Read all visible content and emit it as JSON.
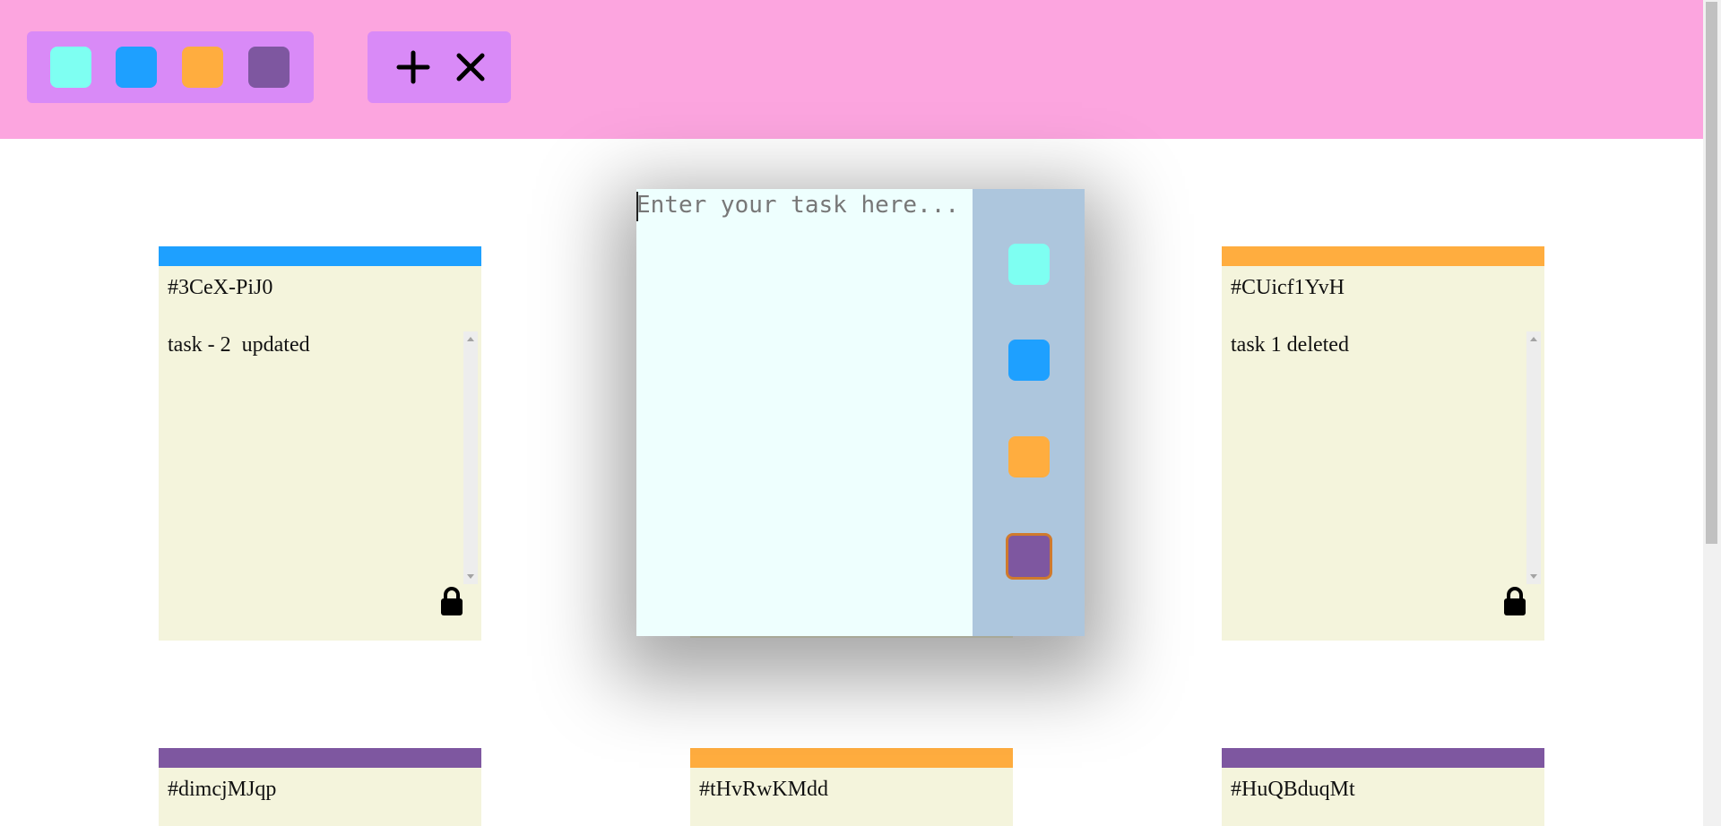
{
  "filter_colors": [
    {
      "name": "lightcyan-filter",
      "color": "#7efff2"
    },
    {
      "name": "blue-filter",
      "color": "#1ea0ff"
    },
    {
      "name": "orange-filter",
      "color": "#ffad3f"
    },
    {
      "name": "purple-filter",
      "color": "#7e57a0"
    }
  ],
  "actions": {
    "add_icon": "plus-icon",
    "remove_icon": "close-icon"
  },
  "tickets": [
    {
      "id": "#3CeX-PiJ0",
      "task": "task - 2  updated",
      "color": "#1ea0ff",
      "locked": true
    },
    {
      "id": "#CUicf1YvH",
      "task": "task 1 deleted",
      "color": "#ffad3f",
      "locked": true
    },
    {
      "id": "#dimcjMJqp",
      "task": "",
      "color": "#7e57a0"
    },
    {
      "id": "#tHvRwKMdd",
      "task": "",
      "color": "#ffad3f"
    },
    {
      "id": "#HuQBduqMt",
      "task": "",
      "color": "#7e57a0"
    }
  ],
  "modal": {
    "placeholder": "Enter your task here...",
    "value": "",
    "priority_colors": [
      "#7efff2",
      "#1ea0ff",
      "#ffad3f",
      "#7e57a0"
    ],
    "selected_priority": "#7e57a0",
    "selected_border_color": "#d07a2d"
  }
}
